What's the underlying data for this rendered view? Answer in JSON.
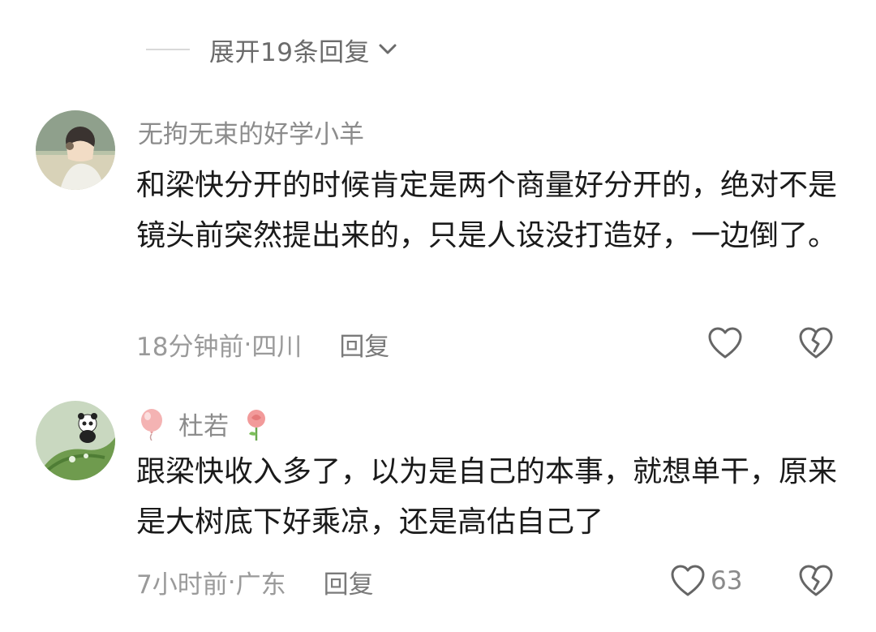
{
  "expand_replies": {
    "label": "展开19条回复"
  },
  "comments": [
    {
      "username": "无拘无束的好学小羊",
      "text": "和梁快分开的时候肯定是两个商量好分开的，绝对不是镜头前突然提出来的，只是人设没打造好，一边倒了。",
      "time": "18分钟前",
      "location": "四川",
      "reply_label": "回复",
      "like_count": ""
    },
    {
      "username": "杜若",
      "text": "跟梁快收入多了，以为是自己的本事，就想单干，原来是大树底下好乘凉，还是高估自己了",
      "time": "7小时前",
      "location": "广东",
      "reply_label": "回复",
      "like_count": "63"
    }
  ],
  "separator": " · ",
  "colors": {
    "text_primary": "#1a1a1a",
    "text_secondary": "#9a9a9a",
    "divider": "#d9d9d9"
  },
  "icons": [
    "chevron-down-icon",
    "heart-icon",
    "broken-heart-icon",
    "balloon-icon",
    "rose-icon",
    "panda-icon"
  ]
}
